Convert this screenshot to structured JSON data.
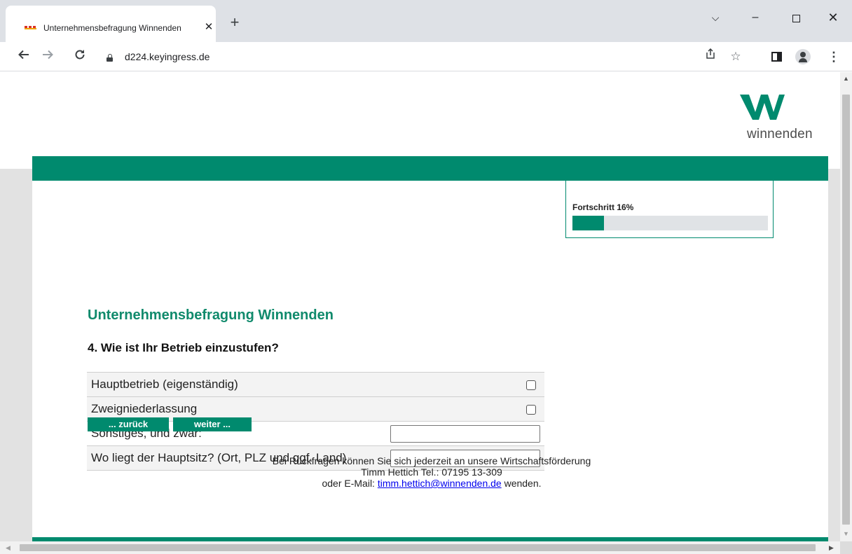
{
  "browser": {
    "tab_title": "Unternehmensbefragung Winnenden",
    "tab_close": "✕",
    "new_tab": "+",
    "url": "d224.keyingress.de",
    "icons": [
      "back-icon",
      "forward-icon",
      "reload-icon",
      "lock-icon",
      "share-icon",
      "star-icon",
      "side-panel-icon",
      "profile-icon",
      "menu-icon"
    ]
  },
  "window_controls": {
    "chevron": "⌵",
    "minimize": "–",
    "close": "✕"
  },
  "logo": {
    "text": "winnenden",
    "color": "#008a6e"
  },
  "progress": {
    "label": "Fortschritt 16%",
    "percent": 16
  },
  "survey": {
    "title": "Unternehmensbefragung Winnenden",
    "question": "4. Wie ist Ihr Betrieb einzustufen?",
    "options": [
      {
        "label": "Hauptbetrieb (eigenständig)",
        "type": "checkbox",
        "checked": false
      },
      {
        "label": "Zweigniederlassung",
        "type": "checkbox",
        "checked": false
      },
      {
        "label": "Sonstiges, und zwar:",
        "type": "text",
        "value": ""
      },
      {
        "label": "Wo liegt der Hauptsitz? (Ort, PLZ und ggf. Land)",
        "type": "text",
        "value": ""
      }
    ],
    "back_label": "... zurück",
    "next_label": "weiter ..."
  },
  "contact": {
    "line1": "Bei Rückfragen können Sie sich jederzeit an unsere Wirtschaftsförderung",
    "line2": "Timm Hettich Tel.: 07195 13-309",
    "line3_prefix": "oder E-Mail: ",
    "email": "timm.hettich@winnenden.de",
    "line3_suffix": " wenden."
  },
  "colors": {
    "brand_green": "#008a6e",
    "title_green": "#108a6c",
    "progress_track": "#e0e3e6"
  }
}
